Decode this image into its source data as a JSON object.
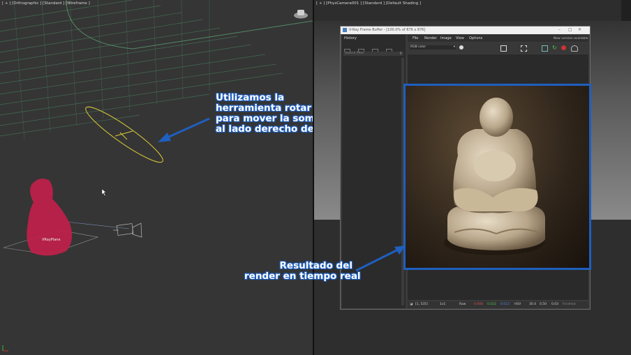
{
  "left_viewport": {
    "label": "[ + ] [Orthographic ] [Standard ] [Wireframe ]",
    "plane_label": "VRayPlane"
  },
  "right_viewport": {
    "label": "[ + ] [PhysCamera001 ] [Standard ] [Default Shading ]"
  },
  "annotations": {
    "rotate_lines": [
      "Utilizamos la",
      "herramienta rotar",
      "para mover la sombrilla",
      "al lado derecho de mi objeto"
    ],
    "render_lines": [
      "Resultado del",
      "render en tiempo real"
    ]
  },
  "vfb": {
    "title": "V-Ray Frame Buffer - [100.0% of 876 x 876]",
    "history_title": "History",
    "search_placeholder": "Search filter",
    "menu": [
      "File",
      "Render",
      "Image",
      "View",
      "Options"
    ],
    "new_version": "New version available",
    "channel": "RGB color",
    "status": {
      "coords": "[1, 535]",
      "ratio": "1x1",
      "mode": "Raw",
      "r": "0.000",
      "g": "0.022",
      "b": "0.013",
      "color_space": "HSV",
      "h": "30.4",
      "s": "0.50",
      "v": "0.03",
      "finished": "Finished"
    }
  },
  "colors": {
    "annotation_blue": "#1f5fbf",
    "plane_red": "#c0204a",
    "sun_yellow": "#d8c838"
  }
}
